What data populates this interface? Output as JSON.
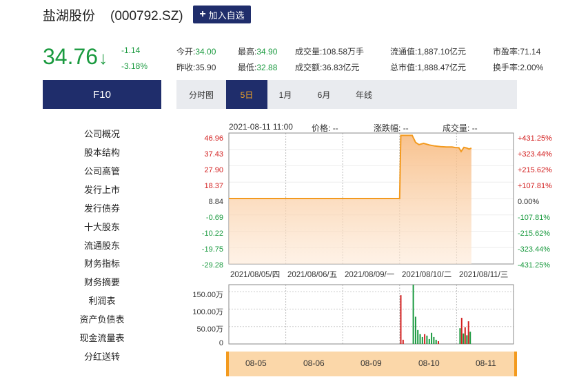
{
  "header": {
    "name": "盐湖股份",
    "code": "(000792.SZ)",
    "add_label": "加入自选",
    "add_icon": "plus-icon"
  },
  "quote": {
    "price": "34.76",
    "direction_icon": "down-arrow-icon",
    "change": "-1.14",
    "change_pct": "-3.18%",
    "color_down": "#1a9a3f",
    "color_up": "#d32020"
  },
  "stats": {
    "open_label": "今开:",
    "open": "34.00",
    "prev_close_label": "昨收:",
    "prev_close": "35.90",
    "high_label": "最高:",
    "high": "34.90",
    "low_label": "最低:",
    "low": "32.88",
    "volume_label": "成交量:",
    "volume": "108.58万手",
    "turnover_label": "成交额:",
    "turnover": "36.83亿元",
    "float_cap_label": "流通值:",
    "float_cap": "1,887.10亿元",
    "total_cap_label": "总市值:",
    "total_cap": "1,888.47亿元",
    "pe_label": "市盈率:",
    "pe": "71.14",
    "turnover_rate_label": "换手率:",
    "turnover_rate": "2.00%"
  },
  "f10_label": "F10",
  "tabs": [
    {
      "label": "分时图",
      "active": false
    },
    {
      "label": "5日",
      "active": true
    },
    {
      "label": "1月",
      "active": false
    },
    {
      "label": "6月",
      "active": false
    },
    {
      "label": "年线",
      "active": false
    }
  ],
  "sidebar": [
    "公司概况",
    "股本结构",
    "公司高管",
    "发行上市",
    "发行债券",
    "十大股东",
    "流通股东",
    "财务指标",
    "财务摘要",
    "利润表",
    "资产负债表",
    "现金流量表",
    "分红送转"
  ],
  "chart_info": {
    "datetime": "2021-08-11 11:00",
    "price_label": "价格:",
    "price_value": "--",
    "chg_label": "涨跌幅:",
    "chg_value": "--",
    "vol_label": "成交量:",
    "vol_value": "--"
  },
  "chart_data": {
    "type": "area",
    "price_axis_left": [
      "46.96",
      "37.43",
      "27.90",
      "18.37",
      "8.84",
      "-0.69",
      "-10.22",
      "-19.75",
      "-29.28"
    ],
    "price_axis_right": [
      "+431.25%",
      "+323.44%",
      "+215.62%",
      "+107.81%",
      "0.00%",
      "-107.81%",
      "-215.62%",
      "-323.44%",
      "-431.25%"
    ],
    "ylim": [
      -29.28,
      46.96
    ],
    "date_labels": [
      "2021/08/05/四",
      "2021/08/06/五",
      "2021/08/09/一",
      "2021/08/10/二",
      "2021/08/11/三"
    ],
    "x_range": [
      0,
      5
    ],
    "price_points": [
      [
        0,
        8.84
      ],
      [
        2.96,
        8.84
      ],
      [
        3.0,
        8.84
      ],
      [
        3.02,
        45.6
      ],
      [
        3.22,
        45.6
      ],
      [
        3.28,
        41.5
      ],
      [
        3.34,
        40.2
      ],
      [
        3.42,
        41.0
      ],
      [
        3.52,
        40.0
      ],
      [
        3.62,
        39.4
      ],
      [
        3.72,
        39.0
      ],
      [
        3.82,
        38.8
      ],
      [
        3.92,
        38.8
      ],
      [
        3.98,
        38.5
      ],
      [
        4.04,
        38.4
      ],
      [
        4.08,
        36.2
      ],
      [
        4.13,
        38.6
      ],
      [
        4.18,
        38.2
      ],
      [
        4.22,
        37.6
      ],
      [
        4.26,
        38.2
      ]
    ],
    "volume_axis": [
      "150.00万",
      "100.00万",
      "50.00万",
      "0"
    ],
    "volume_ylim": [
      0,
      170
    ],
    "volume_bars": [
      {
        "x": 3.02,
        "v": 140,
        "c": "up"
      },
      {
        "x": 3.06,
        "v": 12,
        "c": "up"
      },
      {
        "x": 3.24,
        "v": 175,
        "c": "down"
      },
      {
        "x": 3.28,
        "v": 78,
        "c": "down"
      },
      {
        "x": 3.32,
        "v": 40,
        "c": "down"
      },
      {
        "x": 3.36,
        "v": 28,
        "c": "down"
      },
      {
        "x": 3.4,
        "v": 20,
        "c": "down"
      },
      {
        "x": 3.44,
        "v": 28,
        "c": "up"
      },
      {
        "x": 3.48,
        "v": 24,
        "c": "down"
      },
      {
        "x": 3.52,
        "v": 14,
        "c": "down"
      },
      {
        "x": 3.56,
        "v": 32,
        "c": "down"
      },
      {
        "x": 3.6,
        "v": 20,
        "c": "down"
      },
      {
        "x": 3.64,
        "v": 12,
        "c": "down"
      },
      {
        "x": 3.68,
        "v": 8,
        "c": "up"
      },
      {
        "x": 4.06,
        "v": 45,
        "c": "down"
      },
      {
        "x": 4.09,
        "v": 75,
        "c": "up"
      },
      {
        "x": 4.12,
        "v": 30,
        "c": "down"
      },
      {
        "x": 4.15,
        "v": 48,
        "c": "up"
      },
      {
        "x": 4.18,
        "v": 25,
        "c": "down"
      },
      {
        "x": 4.21,
        "v": 65,
        "c": "up"
      },
      {
        "x": 4.24,
        "v": 35,
        "c": "down"
      }
    ]
  },
  "navigator": [
    "08-05",
    "08-06",
    "08-09",
    "08-10",
    "08-11"
  ]
}
